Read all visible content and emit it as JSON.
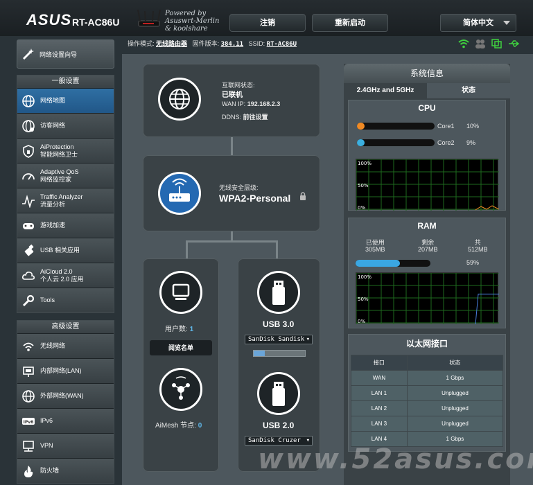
{
  "header": {
    "logo": "ASUS",
    "model": "RT-AC86U",
    "powered_line1": "Powered by",
    "powered_line2": "Asuswrt-Merlin",
    "powered_line3": "& koolshare",
    "logout": "注销",
    "reboot": "重新启动",
    "language": "简体中文"
  },
  "statusbar": {
    "mode_label": "操作模式:",
    "mode_value": "无线路由器",
    "fw_label": "固件版本:",
    "fw_value": "384.11",
    "ssid_label": "SSID:",
    "ssid_value": "RT-AC86U"
  },
  "sidebar": {
    "quick_setup": "网络设置向导",
    "general_title": "一般设置",
    "general": [
      {
        "l1": "网络地图",
        "l2": ""
      },
      {
        "l1": "访客网络",
        "l2": ""
      },
      {
        "l1": "AiProtection",
        "l2": "智能网络卫士"
      },
      {
        "l1": "Adaptive QoS",
        "l2": "网络监控家"
      },
      {
        "l1": "Traffic Analyzer",
        "l2": "流量分析"
      },
      {
        "l1": "游戏加速",
        "l2": ""
      },
      {
        "l1": "USB 相关应用",
        "l2": ""
      },
      {
        "l1": "AiCloud 2.0",
        "l2": "个人云 2.0 应用"
      },
      {
        "l1": "Tools",
        "l2": ""
      }
    ],
    "advanced_title": "高级设置",
    "advanced": [
      {
        "l1": "无线网络"
      },
      {
        "l1": "内部网络(LAN)"
      },
      {
        "l1": "外部网络(WAN)"
      },
      {
        "l1": "IPv6"
      },
      {
        "l1": "VPN"
      },
      {
        "l1": "防火墙"
      }
    ]
  },
  "internet": {
    "label": "互联网状态:",
    "status": "已联机",
    "wan_label": "WAN IP:",
    "wan_ip": "192.168.2.3",
    "ddns_label": "DDNS:",
    "ddns_value": "前往设置"
  },
  "wireless": {
    "label": "无线安全层级:",
    "value": "WPA2-Personal"
  },
  "clients": {
    "label": "用户数:",
    "count": "1",
    "button": "阅览名单"
  },
  "aimesh": {
    "label": "AiMesh 节点:",
    "count": "0"
  },
  "usb3": {
    "label": "USB 3.0",
    "device": "SanDisk Sandisk",
    "usage": 0.22
  },
  "usb2": {
    "label": "USB 2.0",
    "device": "SanDisk Cruzer"
  },
  "sysinfo": {
    "title": "系统信息",
    "tab1": "2.4GHz and 5GHz",
    "tab2": "状态",
    "cpu_title": "CPU",
    "cores": [
      {
        "name": "Core1",
        "pct": "10%",
        "value": 0.1,
        "color": "#f08a24"
      },
      {
        "name": "Core2",
        "pct": "9%",
        "value": 0.09,
        "color": "#3cb0e0"
      }
    ],
    "graph_labels": [
      "100%",
      "50%",
      "0%"
    ],
    "ram_title": "RAM",
    "ram_used_label": "已使用",
    "ram_used": "305MB",
    "ram_free_label": "剩余",
    "ram_free": "207MB",
    "ram_total_label": "共",
    "ram_total": "512MB",
    "ram_pct": "59%",
    "ram_value": 0.59,
    "eth_title": "以太网接口",
    "eth_headers": [
      "接口",
      "状态"
    ],
    "eth_rows": [
      [
        "WAN",
        "1 Gbps"
      ],
      [
        "LAN 1",
        "Unplugged"
      ],
      [
        "LAN 2",
        "Unplugged"
      ],
      [
        "LAN 3",
        "Unplugged"
      ],
      [
        "LAN 4",
        "1 Gbps"
      ]
    ]
  },
  "watermark": "www.52asus.com"
}
